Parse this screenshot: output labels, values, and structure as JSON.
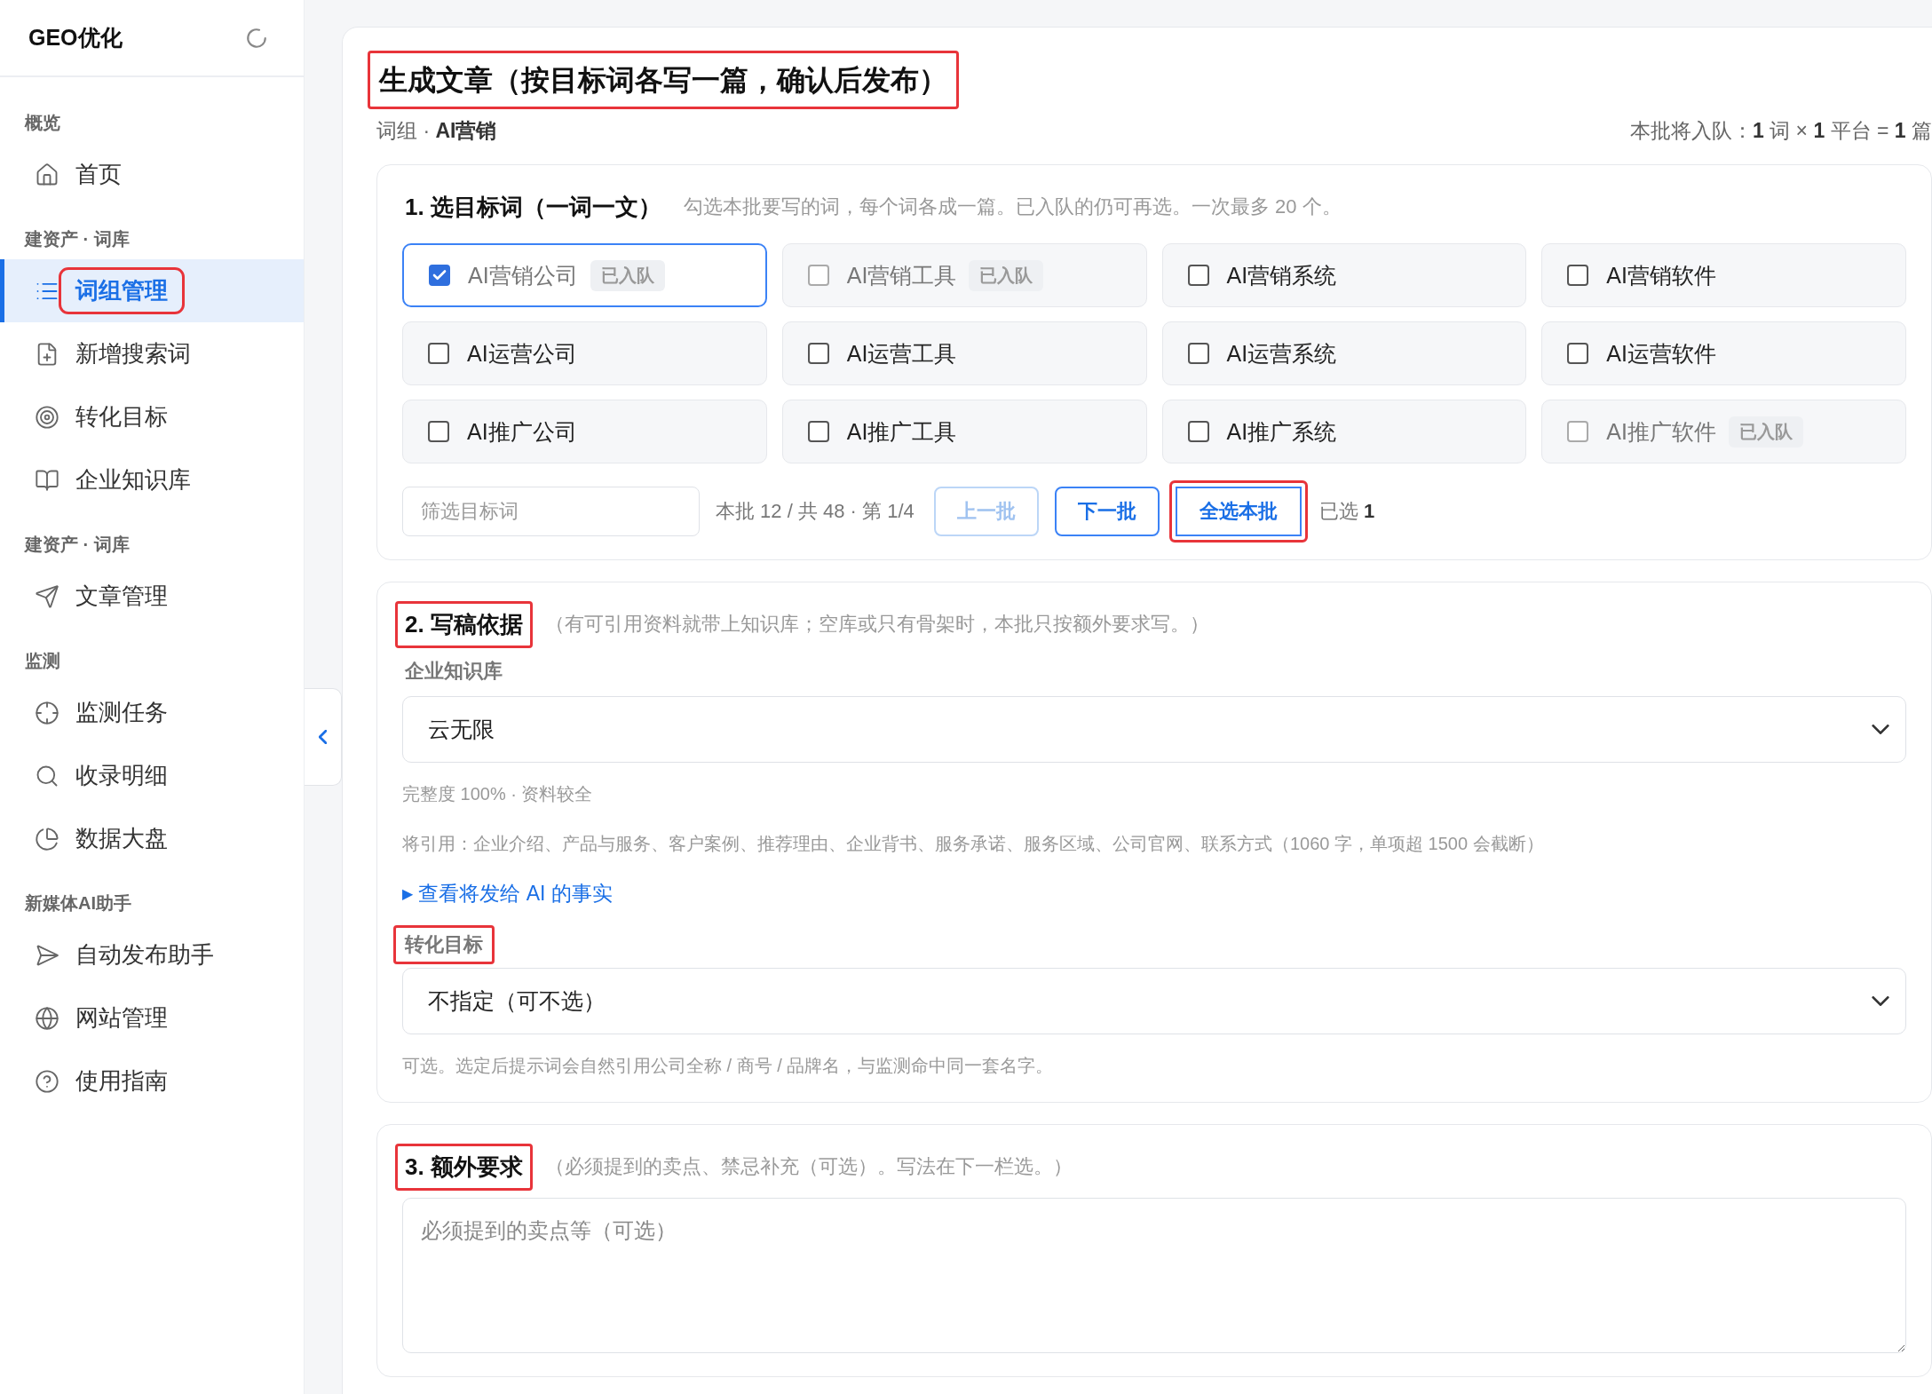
{
  "sidebar": {
    "brand": "GEO优化",
    "groups": [
      {
        "label": "概览",
        "items": [
          {
            "label": "首页",
            "selected": false,
            "highlighted": false
          }
        ]
      },
      {
        "label": "建资产 · 词库",
        "items": [
          {
            "label": "词组管理",
            "selected": true,
            "highlighted": true
          },
          {
            "label": "新增搜索词",
            "selected": false,
            "highlighted": false
          },
          {
            "label": "转化目标",
            "selected": false,
            "highlighted": false
          },
          {
            "label": "企业知识库",
            "selected": false,
            "highlighted": false
          }
        ]
      },
      {
        "label": "建资产 · 词库",
        "items": [
          {
            "label": "文章管理",
            "selected": false,
            "highlighted": false
          }
        ]
      },
      {
        "label": "监测",
        "items": [
          {
            "label": "监测任务",
            "selected": false,
            "highlighted": false
          },
          {
            "label": "收录明细",
            "selected": false,
            "highlighted": false
          },
          {
            "label": "数据大盘",
            "selected": false,
            "highlighted": false
          }
        ]
      },
      {
        "label": "新媒体AI助手",
        "items": [
          {
            "label": "自动发布助手",
            "selected": false,
            "highlighted": false
          },
          {
            "label": "网站管理",
            "selected": false,
            "highlighted": false
          },
          {
            "label": "使用指南",
            "selected": false,
            "highlighted": false
          }
        ]
      }
    ]
  },
  "panel": {
    "title": "生成文章（按目标词各写一篇，确认后发布）",
    "title_highlighted": true,
    "group": "词组 · **AI营销**",
    "summary": "本批将入队：**1** 词 × **1** 平台 = **1** 篇",
    "section_1": {
      "title": "1. 选目标词（一词一文）",
      "highlighted": false,
      "note": "勾选本批要写的词，每个词各成一篇。已入队的仍可再选。一次最多 20 个。",
      "words": [
        {
          "label": "AI营销公司",
          "checked": true,
          "badge": "已入队"
        },
        {
          "label": "AI营销工具",
          "checked": false,
          "badge": "已入队"
        },
        {
          "label": "AI营销系统",
          "checked": false
        },
        {
          "label": "AI营销软件",
          "checked": false
        },
        {
          "label": "AI运营公司",
          "checked": false
        },
        {
          "label": "AI运营工具",
          "checked": false
        },
        {
          "label": "AI运营系统",
          "checked": false
        },
        {
          "label": "AI运营软件",
          "checked": false
        },
        {
          "label": "AI推广公司",
          "checked": false
        },
        {
          "label": "AI推广工具",
          "checked": false
        },
        {
          "label": "AI推广系统",
          "checked": false
        },
        {
          "label": "AI推广软件",
          "checked": false,
          "badge": "已入队"
        }
      ],
      "filter": {
        "placeholder": "筛选目标词"
      },
      "page_info": "本批 12 / 共 48 · 第 1/4",
      "buttons": [
        {
          "label": "上一批",
          "disabled": true,
          "highlighted": false
        },
        {
          "label": "下一批",
          "disabled": false,
          "highlighted": false
        },
        {
          "label": "全选本批",
          "disabled": false,
          "highlighted": true
        }
      ],
      "selected_count": "已选 **1**"
    },
    "section_2": {
      "title": "2. 写稿依据",
      "highlighted": true,
      "note": "（有可引用资料就带上知识库；空库或只有骨架时，本批只按额外要求写。）",
      "knowledge_label": "企业知识库",
      "knowledge_value": "云无限",
      "completeness": "完整度 100% · 资料较全",
      "citations": "将引用：企业介绍、产品与服务、客户案例、推荐理由、企业背书、服务承诺、服务区域、公司官网、联系方式（1060 字，单项超 1500 会截断）",
      "disclosure": {
        "marker": "▶",
        "label": "查看将发给 AI 的事实",
        "expanded": false
      },
      "goal_label": "转化目标",
      "goal_label_highlighted": true,
      "goal_value": "不指定（可不选）",
      "goal_hint": "可选。选定后提示词会自然引用公司全称 / 商号 / 品牌名，与监测命中同一套名字。"
    },
    "section_3": {
      "title": "3. 额外要求",
      "highlighted": true,
      "note": "（必须提到的卖点、禁忌补充（可选）。写法在下一栏选。）",
      "requirements": {
        "placeholder": "必须提到的卖点等（可选）"
      }
    }
  }
}
